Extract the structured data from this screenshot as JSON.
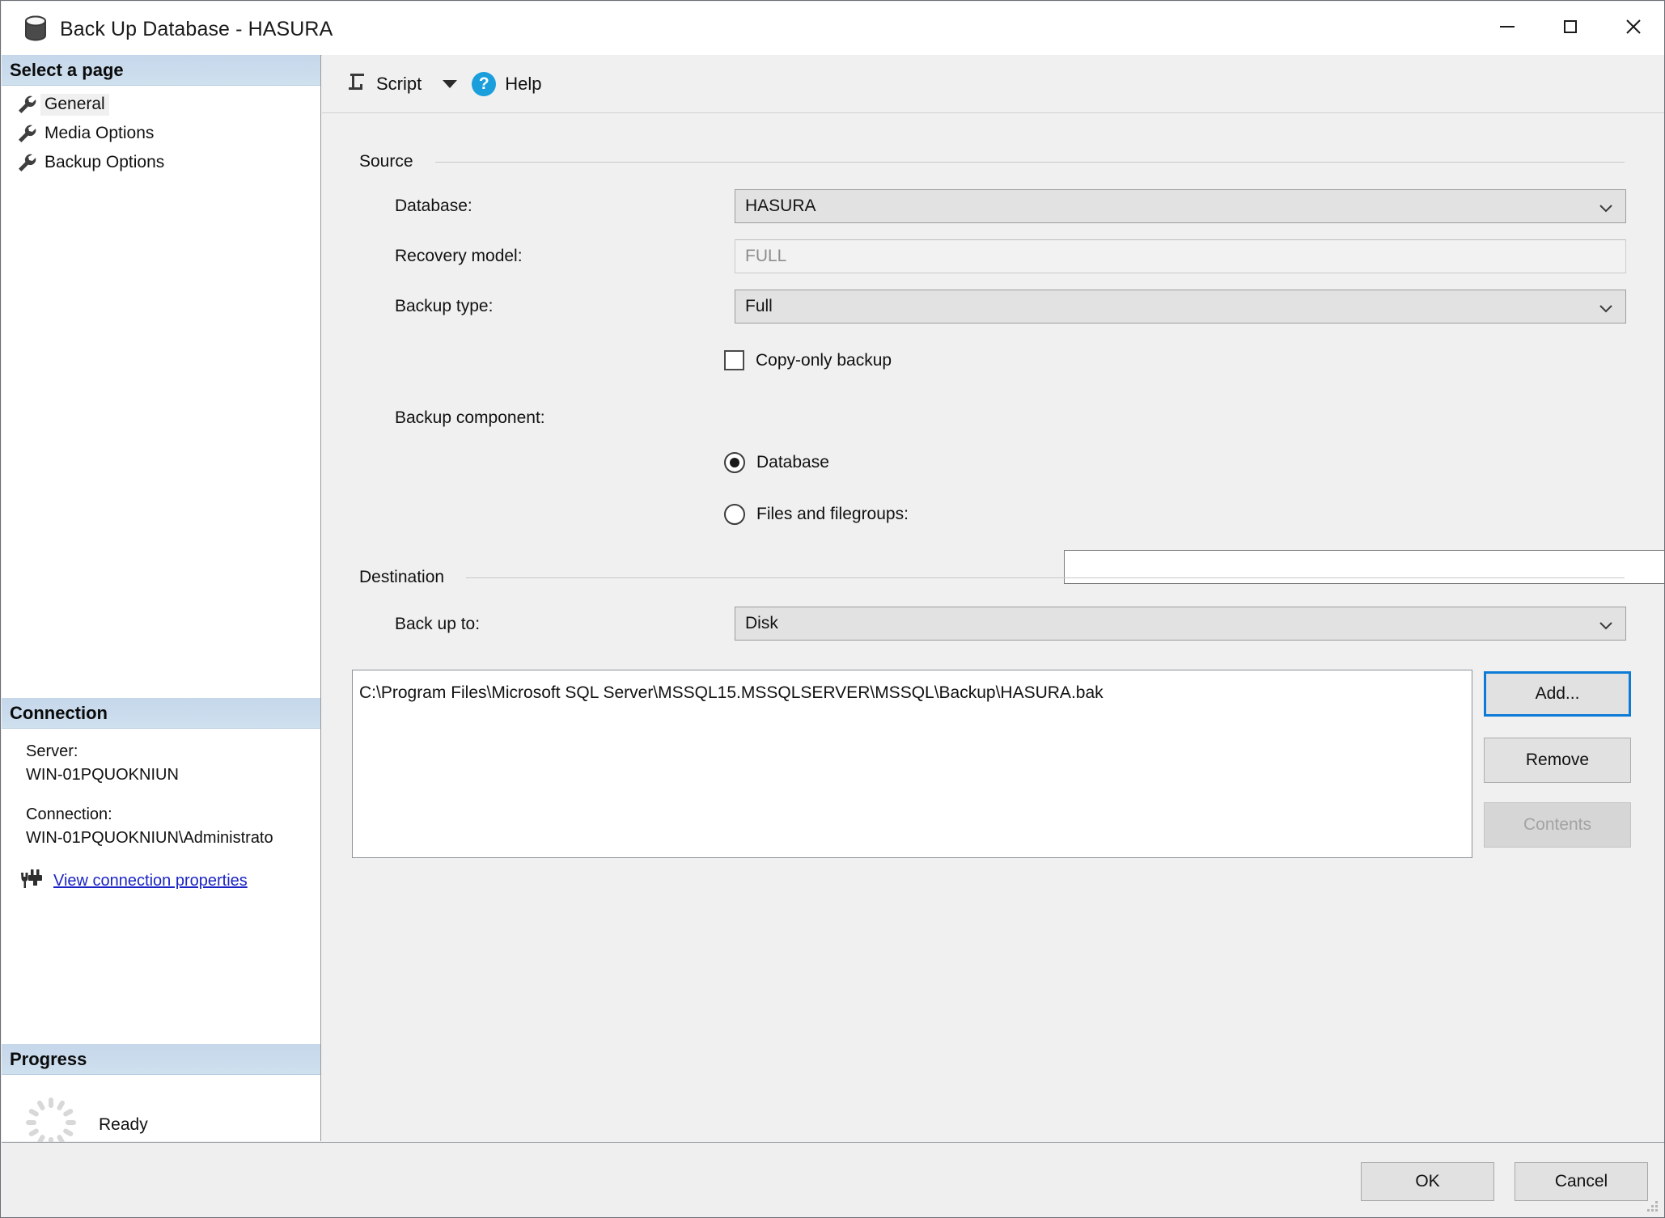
{
  "window": {
    "title": "Back Up Database - HASURA",
    "icon": "database-icon",
    "controls": {
      "minimize": "minimize-icon",
      "maximize": "maximize-icon",
      "close": "close-icon"
    }
  },
  "sidebar": {
    "select_page_header": "Select a page",
    "pages": [
      {
        "label": "General",
        "selected": true
      },
      {
        "label": "Media Options",
        "selected": false
      },
      {
        "label": "Backup Options",
        "selected": false
      }
    ],
    "connection": {
      "header": "Connection",
      "server_label": "Server:",
      "server_value": "WIN-01PQUOKNIUN",
      "connection_label": "Connection:",
      "connection_value": "WIN-01PQUOKNIUN\\Administrato",
      "link": "View connection properties",
      "link_icon": "connection-plug-icon"
    },
    "progress": {
      "header": "Progress",
      "status": "Ready",
      "spinner_icon": "progress-spinner-icon"
    }
  },
  "toolbar": {
    "script_label": "Script",
    "script_icon": "script-icon",
    "script_caret": "chevron-down-icon",
    "help_label": "Help",
    "help_icon": "help-question-icon"
  },
  "source": {
    "group_title": "Source",
    "database_label": "Database:",
    "database_value": "HASURA",
    "recovery_label": "Recovery model:",
    "recovery_value": "FULL",
    "backup_type_label": "Backup type:",
    "backup_type_value": "Full",
    "copy_only_label": "Copy-only backup",
    "copy_only_checked": false,
    "backup_component_label": "Backup component:",
    "component_database_label": "Database",
    "component_database_selected": true,
    "component_files_label": "Files and filegroups:",
    "component_files_selected": false,
    "files_input_value": "",
    "browse_label": "..."
  },
  "destination": {
    "group_title": "Destination",
    "back_up_to_label": "Back up to:",
    "back_up_to_value": "Disk",
    "items": [
      "C:\\Program Files\\Microsoft SQL Server\\MSSQL15.MSSQLSERVER\\MSSQL\\Backup\\HASURA.bak"
    ],
    "buttons": {
      "add": "Add...",
      "remove": "Remove",
      "contents": "Contents"
    }
  },
  "footer": {
    "ok": "OK",
    "cancel": "Cancel"
  },
  "colors": {
    "accent_blue": "#0d7bd6",
    "link_blue": "#1a24c4",
    "help_blue": "#1a9fdc",
    "header_band": "#c9dbec"
  }
}
